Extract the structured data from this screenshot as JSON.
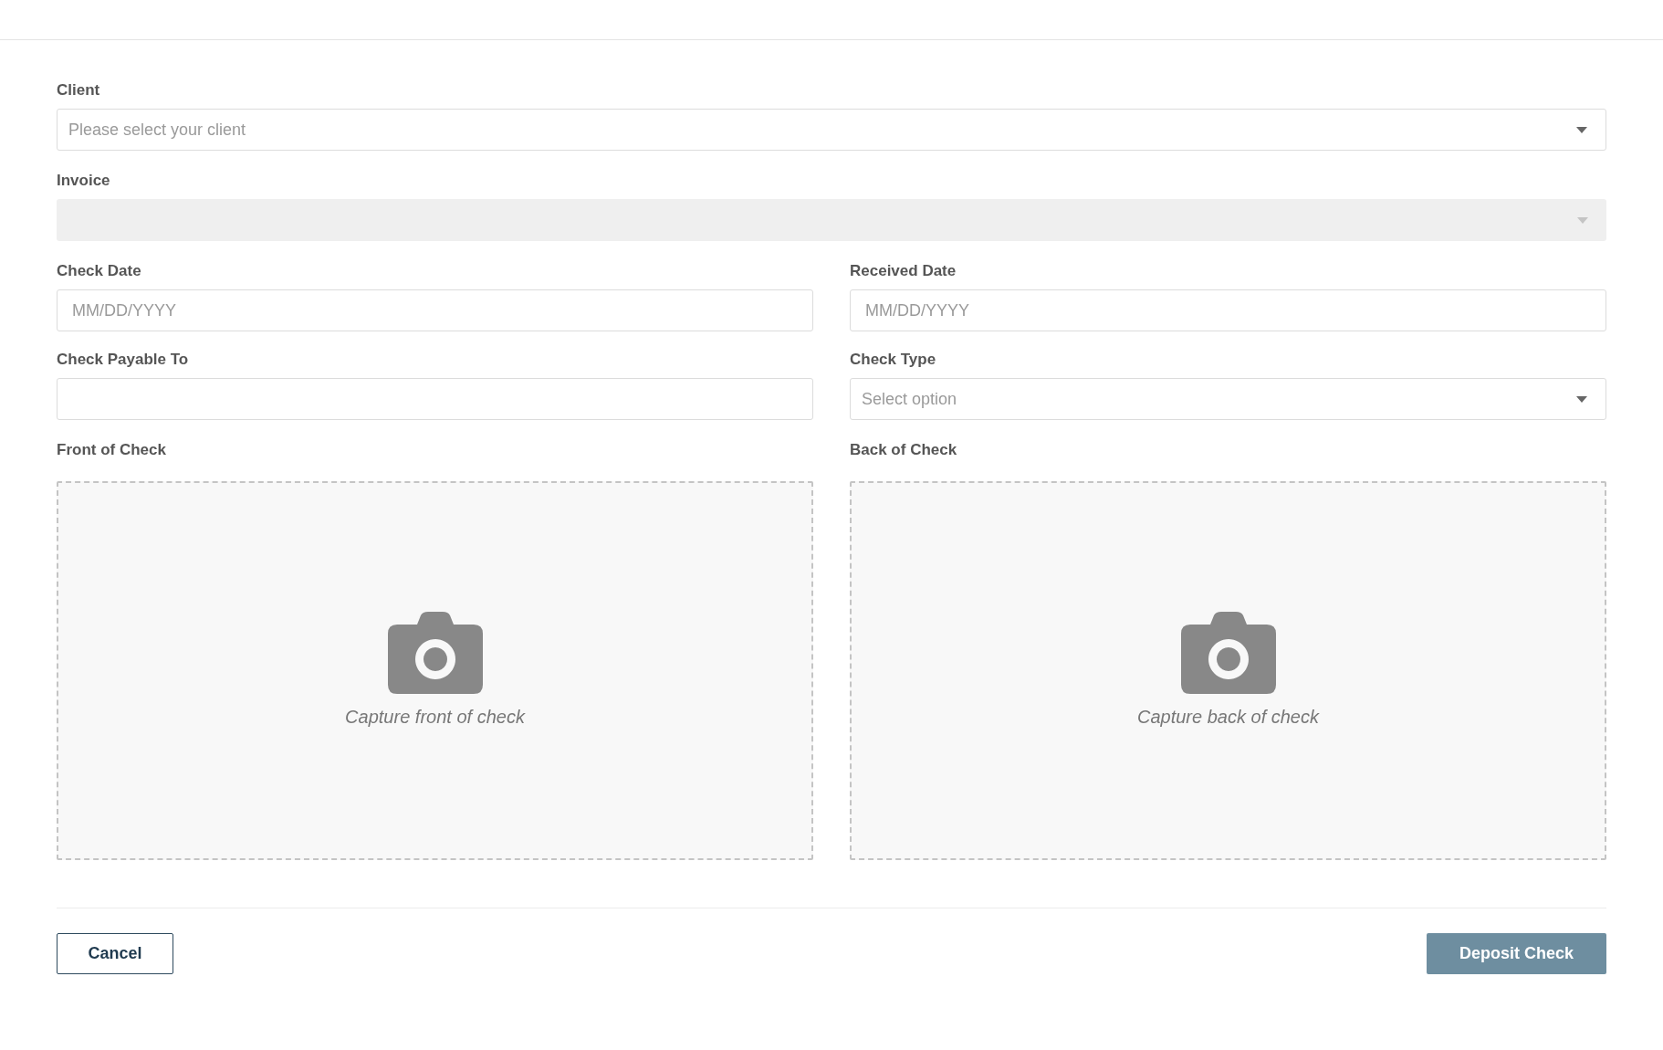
{
  "full_fields": [
    {
      "kind": "select",
      "label": "Client",
      "placeholder": "Please select your client",
      "disabled": false
    },
    {
      "kind": "select",
      "label": "Invoice",
      "disabled": true
    }
  ],
  "grid_fields": [
    {
      "kind": "input",
      "label": "Check Date",
      "placeholder": "MM/DD/YYYY"
    },
    {
      "kind": "input",
      "label": "Received Date",
      "placeholder": "MM/DD/YYYY"
    },
    {
      "kind": "input",
      "label": "Check Payable To"
    },
    {
      "kind": "select",
      "label": "Check Type",
      "placeholder": "Select option",
      "disabled": false
    },
    {
      "kind": "upload",
      "label": "Front of Check",
      "caption": "Capture front of check"
    },
    {
      "kind": "upload",
      "label": "Back of Check",
      "caption": "Capture back of check"
    }
  ],
  "buttons": {
    "cancel": "Cancel",
    "submit": "Deposit Check"
  }
}
